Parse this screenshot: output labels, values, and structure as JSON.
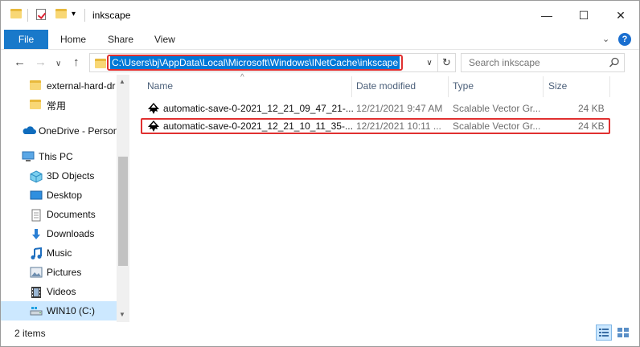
{
  "window": {
    "title": "inkscape",
    "controls": {
      "minimize": "—",
      "maximize": "☐",
      "close": "✕"
    }
  },
  "ribbon": {
    "tabs": [
      "File",
      "Home",
      "Share",
      "View"
    ],
    "expand_icon": "chevron-down-icon",
    "help_label": "?"
  },
  "navigation": {
    "back_icon": "←",
    "forward_icon": "→",
    "recent_icon": "∨",
    "up_icon": "↑",
    "address": "C:\\Users\\bj\\AppData\\Local\\Microsoft\\Windows\\INetCache\\inkscape",
    "search_placeholder": "Search inkscape"
  },
  "nav_pane": {
    "items": [
      {
        "label": "external-hard-dr",
        "icon": "folder-icon"
      },
      {
        "label": "常用",
        "icon": "folder-icon"
      },
      {
        "label": "OneDrive - Person",
        "icon": "onedrive-icon"
      },
      {
        "label": "This PC",
        "icon": "pc-icon"
      },
      {
        "label": "3D Objects",
        "icon": "3d-objects-icon"
      },
      {
        "label": "Desktop",
        "icon": "desktop-icon"
      },
      {
        "label": "Documents",
        "icon": "documents-icon"
      },
      {
        "label": "Downloads",
        "icon": "downloads-icon"
      },
      {
        "label": "Music",
        "icon": "music-icon"
      },
      {
        "label": "Pictures",
        "icon": "pictures-icon"
      },
      {
        "label": "Videos",
        "icon": "videos-icon"
      },
      {
        "label": "WIN10 (C:)",
        "icon": "drive-icon",
        "selected": true
      }
    ]
  },
  "file_list": {
    "columns": [
      "Name",
      "Date modified",
      "Type",
      "Size"
    ],
    "sort_indicator": "^",
    "rows": [
      {
        "name": "automatic-save-0-2021_12_21_09_47_21-...",
        "date": "12/21/2021 9:47 AM",
        "type": "Scalable Vector Gr...",
        "size": "24 KB"
      },
      {
        "name": "automatic-save-0-2021_12_21_10_11_35-...",
        "date": "12/21/2021 10:11 ...",
        "type": "Scalable Vector Gr...",
        "size": "24 KB",
        "highlighted": true
      }
    ]
  },
  "status": {
    "item_count": "2 items"
  },
  "colors": {
    "file_tab": "#1979ca",
    "selection": "#0078d7",
    "highlight_outline": "#e03030",
    "nav_selected": "#cce8ff"
  }
}
